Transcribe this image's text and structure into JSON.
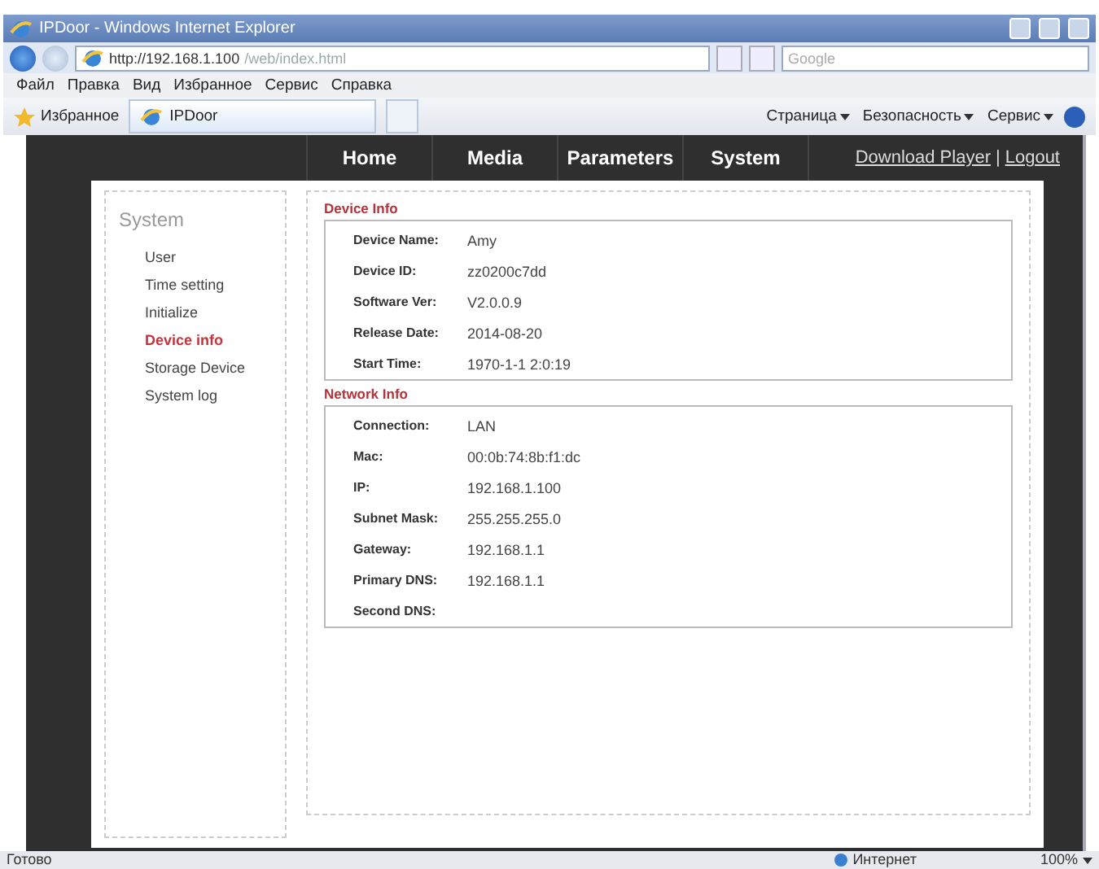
{
  "window": {
    "title": "IPDoor - Windows Internet Explorer"
  },
  "address_bar": {
    "url_host": "http://192.168.1.100",
    "url_path": "/web/index.html",
    "search_placeholder": "Google"
  },
  "menu_bar": [
    "Файл",
    "Правка",
    "Вид",
    "Избранное",
    "Сервис",
    "Справка"
  ],
  "favorites_bar": {
    "favorites": "Избранное",
    "tab": "IPDoor",
    "commands": [
      "Страница",
      "Безопасность",
      "Сервис"
    ]
  },
  "nav": {
    "items": [
      "Home",
      "Media",
      "Parameters",
      "System"
    ],
    "links": [
      "Download Player",
      "Logout"
    ],
    "separator": "|"
  },
  "sidebar": {
    "title": "System",
    "items": [
      {
        "label": "User",
        "selected": false
      },
      {
        "label": "Time setting",
        "selected": false
      },
      {
        "label": "Initialize",
        "selected": false
      },
      {
        "label": "Device info",
        "selected": true
      },
      {
        "label": "Storage Device",
        "selected": false
      },
      {
        "label": "System log",
        "selected": false
      }
    ]
  },
  "sections": [
    {
      "title": "Device Info",
      "rows": [
        {
          "label": "Device Name:",
          "value": "Amy"
        },
        {
          "label": "Device ID:",
          "value": "zz0200c7dd"
        },
        {
          "label": "Software Ver:",
          "value": "V2.0.0.9"
        },
        {
          "label": "Release Date:",
          "value": "2014-08-20"
        },
        {
          "label": "Start Time:",
          "value": "1970-1-1 2:0:19"
        }
      ]
    },
    {
      "title": "Network Info",
      "rows": [
        {
          "label": "Connection:",
          "value": "LAN"
        },
        {
          "label": "Mac:",
          "value": "00:0b:74:8b:f1:dc"
        },
        {
          "label": "IP:",
          "value": "192.168.1.100"
        },
        {
          "label": "Subnet Mask:",
          "value": "255.255.255.0"
        },
        {
          "label": "Gateway:",
          "value": "192.168.1.1"
        },
        {
          "label": "Primary DNS:",
          "value": "192.168.1.1"
        },
        {
          "label": "Second DNS:"
        }
      ]
    }
  ],
  "status_bar": {
    "status": "Готово",
    "zone": "Интернет",
    "zoom": "100%"
  }
}
